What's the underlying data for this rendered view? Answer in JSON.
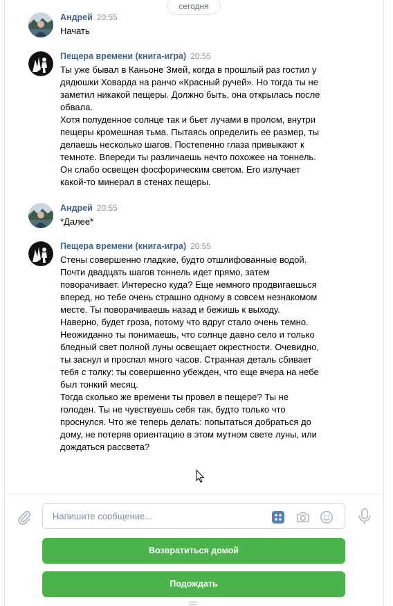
{
  "date_divider": "сегодня",
  "messages": [
    {
      "author": "Андрей",
      "time": "20:55",
      "lines": [
        "Начать"
      ]
    },
    {
      "author": "Пещера времени (книга-игра)",
      "time": "20:55",
      "lines": [
        "Ты уже бывал в Каньоне Змей, когда в прошлый раз гостил у",
        "дядюшки Ховарда на ранчо «Красный ручей». Но тогда ты не",
        "заметил никакой пещеры. Должно быть, она открылась после",
        "обвала.",
        "Хотя полуденное солнце так и бьет лучами в пролом, внутри",
        "пещеры кромешная тьма. Пытаясь определить ее размер, ты",
        "делаешь несколько шагов. Постепенно глаза привыкают к",
        "темноте. Впереди ты различаешь нечто похожее на тоннель.",
        "Он слабо освещен фосфорическим светом. Его излучает",
        "какой-то минерал в стенах пещеры."
      ]
    },
    {
      "author": "Андрей",
      "time": "20:55",
      "lines": [
        "*Далее*"
      ]
    },
    {
      "author": "Пещера времени (книга-игра)",
      "time": "20:55",
      "lines": [
        "Стены совершенно гладкие, будто отшлифованные водой.",
        "Почти двадцать шагов тоннель идет прямо, затем",
        "поворачивает. Интересно куда? Еще немного продвигаешься",
        "вперед, но тебе очень страшно одному в совсем незнакомом",
        "месте. Ты поворачиваешь назад и бежишь к выходу.",
        "Наверно, будет гроза, потому что вдруг стало очень темно.",
        "Неожиданно ты понимаешь, что солнце давно село и только",
        "бледный свет полной луны освещает окрестности. Очевидно,",
        "ты заснул и проспал много часов. Странная деталь сбивает",
        "тебя с толку: ты совершенно убежден, что еще вчера на небе",
        "был тонкий месяц.",
        "Тогда сколько же времени ты провел в пещере? Ты не",
        "голоден. Ты не чувствуешь себя так, будто только что",
        "проснулся. Что же теперь делать: попытаться добраться до",
        "дому, не потеряв ориентацию в этом мутном свете луны, или",
        "дождаться рассвета?"
      ]
    }
  ],
  "composer": {
    "placeholder": "Напишите сообщение...",
    "icons": [
      "paperclip-icon",
      "keyboard-grid-icon",
      "camera-icon",
      "smile-icon",
      "microphone-icon"
    ]
  },
  "keyboard_buttons": [
    {
      "label": "Возвратиться домой"
    },
    {
      "label": "Подождать"
    }
  ],
  "colors": {
    "author": "#42648b",
    "time": "#939393",
    "button_bg": "#4bb34b",
    "button_text": "#ffffff",
    "border": "#dce1e6"
  }
}
